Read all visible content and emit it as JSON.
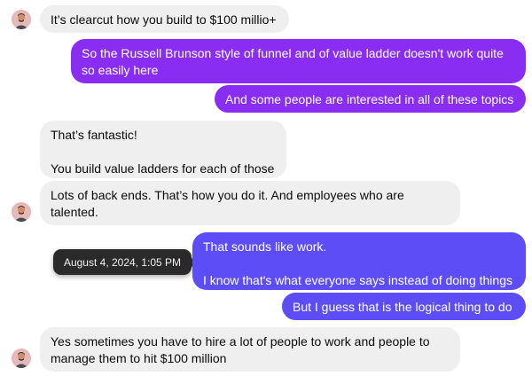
{
  "thread": {
    "messages": [
      {
        "direction": "received",
        "text": "It’s clearcut how you build to $100 millio+"
      },
      {
        "direction": "sent",
        "text": "So the Russell Brunson style of funnel and of value ladder doesn't work quite so easily here"
      },
      {
        "direction": "sent",
        "text": "And some people are interested in all of these topics"
      },
      {
        "direction": "received",
        "text": "That’s fantastic!\n\nYou build value ladders for each of those"
      },
      {
        "direction": "received",
        "text": "Lots of back ends. That’s how you do it. And employees who are talented."
      },
      {
        "direction": "sent",
        "text": "That sounds like work.\n\nI know that's what everyone says instead of doing things"
      },
      {
        "direction": "sent",
        "text": "But I guess that is the logical thing to do"
      },
      {
        "direction": "received",
        "text": "Yes sometimes you have to hire a lot of people to work and people to manage them to hit $100 million"
      }
    ],
    "timestamp_tooltip": "August 4, 2024, 1:05 PM"
  },
  "colors": {
    "sent_purple": "#8a2df3",
    "sent_indigo": "#5d4df6",
    "received_bg": "#efefef",
    "tooltip_bg": "#2a2a2a",
    "avatar_bg": "#e6b8b9"
  },
  "icons": {
    "avatar": "contact-avatar-icon"
  }
}
